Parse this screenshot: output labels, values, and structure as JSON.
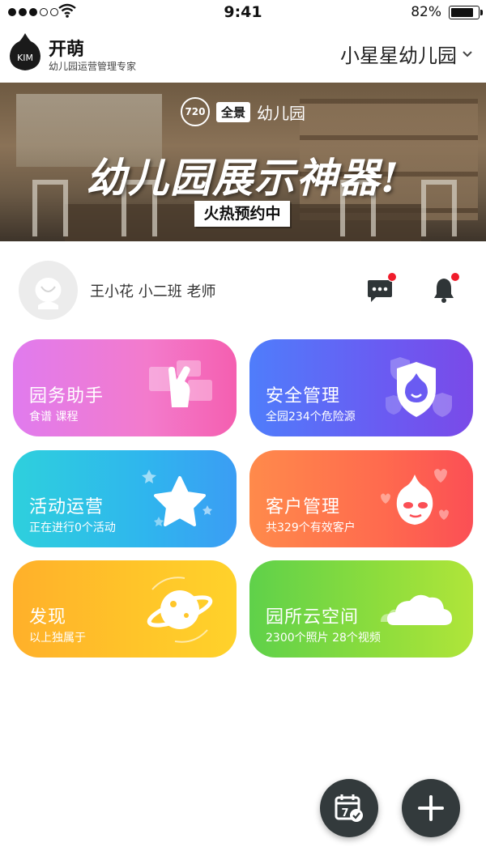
{
  "status_bar": {
    "time": "9:41",
    "battery_percent": "82%",
    "signal_bars_filled": 3,
    "signal_bars_total": 5,
    "battery_level": 0.82
  },
  "header": {
    "logo_text": "KIM",
    "brand_name": "开萌",
    "brand_subtitle": "幼儿园运营管理专家",
    "school_name": "小星星幼儿园",
    "school_dropdown_icon": "chevron-down-icon"
  },
  "banner": {
    "badge": "720",
    "tag": "全景",
    "tag_suffix": "幼儿园",
    "title": "幼儿园展示神器!",
    "cta": "火热预约中"
  },
  "user": {
    "info": "王小花  小二班  老师",
    "message_icon": "chat-bubble-icon",
    "notification_icon": "bell-icon",
    "has_unread_messages": true,
    "has_unread_notifications": true
  },
  "cards": [
    {
      "title": "园务助手",
      "subtitle": "食谱  课程",
      "icon": "hand-documents-icon",
      "color_start": "#e07bee",
      "color_end": "#f45fb0"
    },
    {
      "title": "安全管理",
      "subtitle": "全园234个危险源",
      "icon": "shield-mascot-icon",
      "color_start": "#4f7dfb",
      "color_end": "#7a4ae8"
    },
    {
      "title": "活动运营",
      "subtitle": "正在进行0个活动",
      "icon": "star-icon",
      "color_start": "#2ed0dd",
      "color_end": "#3b9df4"
    },
    {
      "title": "客户管理",
      "subtitle": "共329个有效客户",
      "icon": "heart-mascot-icon",
      "color_start": "#ff8a4b",
      "color_end": "#fb4f55"
    },
    {
      "title": "发现",
      "subtitle": "以上独属于",
      "icon": "planet-icon",
      "color_start": "#ffb02a",
      "color_end": "#ffd22b"
    },
    {
      "title": "园所云空间",
      "subtitle": "2300个照片  28个视频",
      "icon": "cloud-icon",
      "color_start": "#5fd14a",
      "color_end": "#b0e53a"
    }
  ],
  "fab": {
    "calendar_icon": "calendar-check-icon",
    "calendar_day": "7",
    "add_icon": "plus-icon",
    "color": "#333a3c"
  }
}
